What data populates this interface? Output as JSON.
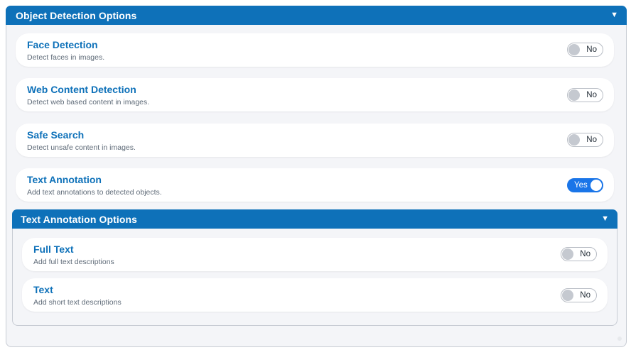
{
  "object_detection": {
    "title": "Object Detection Options",
    "options": [
      {
        "label": "Face Detection",
        "description": "Detect faces in images.",
        "state": "No"
      },
      {
        "label": "Web Content Detection",
        "description": "Detect web based content in images.",
        "state": "No"
      },
      {
        "label": "Safe Search",
        "description": "Detect unsafe content in images.",
        "state": "No"
      },
      {
        "label": "Text Annotation",
        "description": "Add text annotations to detected objects.",
        "state": "Yes"
      }
    ]
  },
  "text_annotation": {
    "title": "Text Annotation Options",
    "options": [
      {
        "label": "Full Text",
        "description": "Add full text descriptions",
        "state": "No"
      },
      {
        "label": "Text",
        "description": "Add short text descriptions",
        "state": "No"
      }
    ]
  },
  "icons": {
    "collapse": "triangle-down-icon"
  },
  "colors": {
    "header": "#0e71b9",
    "toggle_on": "#1a75e8",
    "label": "#0e71b9"
  }
}
